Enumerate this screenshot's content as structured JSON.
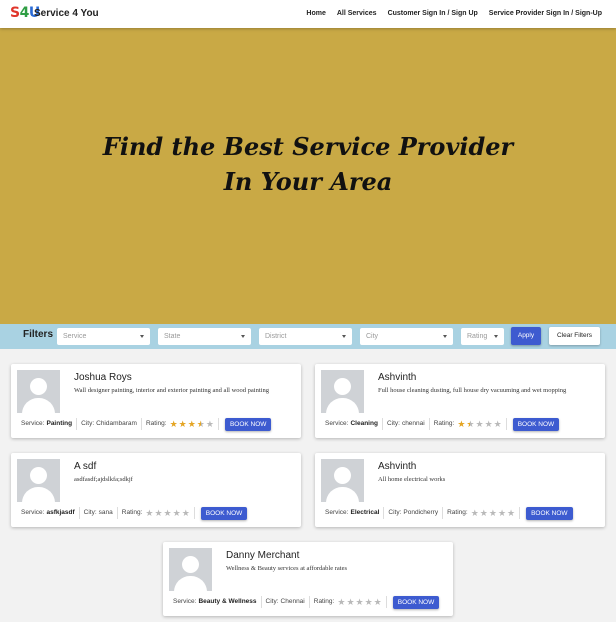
{
  "nav": {
    "logo": {
      "l1": "S",
      "l2": "4",
      "l3": "U"
    },
    "brand": "Service 4 You",
    "links": [
      "Home",
      "All Services",
      "Customer Sign In / Sign Up",
      "Service Provider Sign In / Sign-Up"
    ]
  },
  "hero": {
    "line1": "Find the Best Service Provider",
    "line2": "In Your Area",
    "background": "#c9a945"
  },
  "filters": {
    "title": "Filters",
    "service": "Service",
    "state": "State",
    "district": "District",
    "city": "City",
    "rating": "Rating",
    "apply": "Apply",
    "clear": "Clear Filters"
  },
  "labels": {
    "service": "Service:",
    "city": "City:",
    "rating": "Rating:",
    "book": "BOOK NOW"
  },
  "providers": [
    {
      "name": "Joshua Roys",
      "description": "Wall designer painting, interior and exterior painting and all wood painting",
      "service": "Painting",
      "city": "Chidambaram",
      "rating": 3.5
    },
    {
      "name": "Ashvinth",
      "description": "Full house cleaning dusting, full house dry vacuuming and wet mopping",
      "service": "Cleaning",
      "city": "chennai",
      "rating": 1.5
    },
    {
      "name": "A sdf",
      "description": "asdfasdf;ajdslkfa;sdkjf",
      "service": "asfkjasdf",
      "city": "sana",
      "rating": 0
    },
    {
      "name": "Ashvinth",
      "description": "All home electrical works",
      "service": "Electrical",
      "city": "Pondicherry",
      "rating": 0
    },
    {
      "name": "Danny Merchant",
      "description": "Wellness & Beauty services at affordable rates",
      "service": "Beauty & Wellness",
      "city": "Chennai",
      "rating": 0
    }
  ],
  "colors": {
    "accent": "#3d5bd0",
    "filter_bar": "#a9d2e2",
    "star": "#e4a524"
  }
}
